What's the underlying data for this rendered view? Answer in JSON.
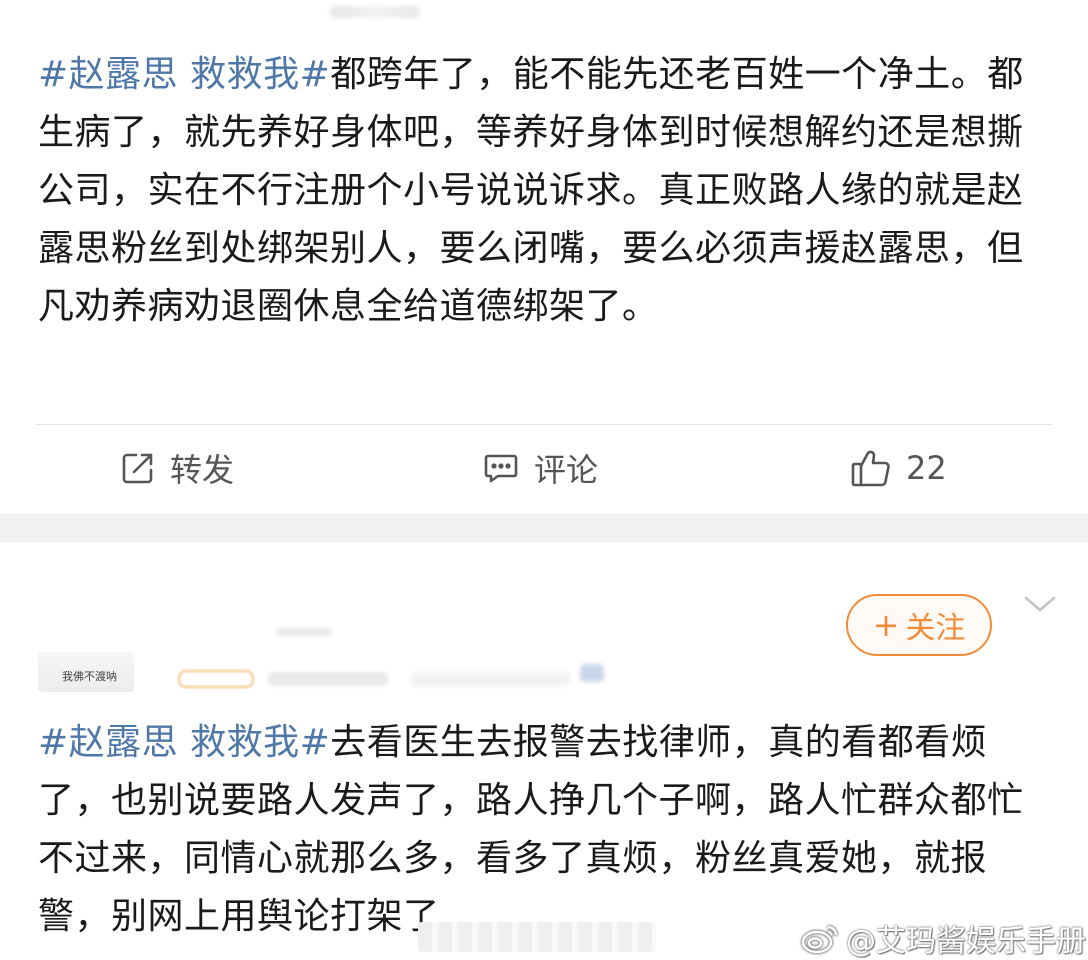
{
  "post1": {
    "hashtag": "#赵露思 救救我#",
    "body": "都跨年了，能不能先还老百姓一个净土。都生病了，就先养好身体吧，等养好身体到时候想解约还是想撕公司，实在不行注册个小号说说诉求。真正败路人缘的就是赵露思粉丝到处绑架别人，要么闭嘴，要么必须声援赵露思，但凡劝养病劝退圈休息全给道德绑架了。",
    "actions": {
      "repost_label": "转发",
      "comment_label": "评论",
      "like_count": "22"
    }
  },
  "post2": {
    "follow_label": "关注",
    "follow_plus": "+",
    "avatar_text": "我佛不渡呐",
    "hashtag": "#赵露思 救救我#",
    "body": "去看医生去报警去找律师，真的看都看烦了，也别说要路人发声了，路人挣几个子啊，路人忙群众都忙不过来，同情心就那么多，看多了真烦，粉丝真爱她，就报警，别网上用舆论打架了"
  },
  "watermark": {
    "text": "@艾玛酱娱乐手册"
  },
  "colors": {
    "hashtag": "#4f78a8",
    "accent_orange": "#f28b38",
    "text": "#1a1a1a",
    "gap": "#f1f1f1"
  }
}
